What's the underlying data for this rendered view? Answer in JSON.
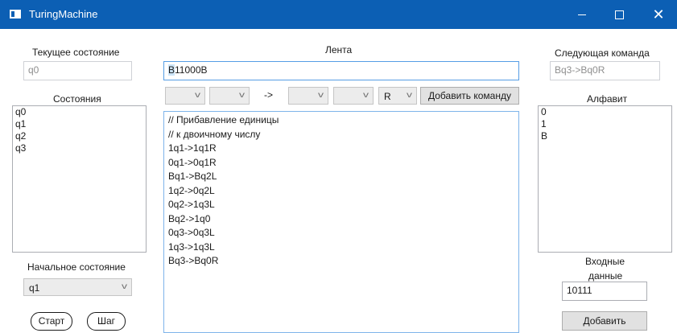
{
  "window": {
    "title": "TuringMachine"
  },
  "current_state": {
    "label": "Текущее состояние",
    "value": "q0"
  },
  "tape": {
    "label": "Лента",
    "value_first": "B",
    "value_rest": "11000B"
  },
  "next_command": {
    "label": "Следующая команда",
    "value": "Bq3->Bq0R"
  },
  "states": {
    "label": "Состояния",
    "items": [
      "q0",
      "q1",
      "q2",
      "q3"
    ]
  },
  "command_builder": {
    "arrow": "->",
    "direction": "R",
    "add_button": "Добавить команду"
  },
  "program": {
    "lines": [
      "// Прибавление единицы",
      "// к двоичному числу",
      "1q1->1q1R",
      "0q1->0q1R",
      "Bq1->Bq2L",
      "1q2->0q2L",
      "0q2->1q3L",
      "Bq2->1q0",
      "0q3->0q3L",
      "1q3->1q3L",
      "Bq3->Bq0R"
    ]
  },
  "alphabet": {
    "label": "Алфавит",
    "items": [
      "0",
      "1",
      "B"
    ]
  },
  "initial_state": {
    "label": "Начальное состояние",
    "value": "q1"
  },
  "input_data": {
    "label_line1": "Входные",
    "label_line2": "данные",
    "value": "10111",
    "add_button": "Добавить"
  },
  "controls": {
    "start": "Старт",
    "step": "Шаг"
  }
}
